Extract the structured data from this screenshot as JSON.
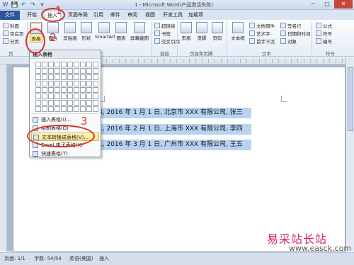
{
  "title": {
    "quick_access": [
      "W",
      "💾",
      "↶",
      "↷",
      "▾"
    ],
    "window_title": "1 - Microsoft Word(产品激活失败)"
  },
  "window_buttons": [
    "─",
    "□",
    "✕"
  ],
  "tabs": [
    "文件",
    "开始",
    "插入",
    "页面布局",
    "引用",
    "邮件",
    "审阅",
    "视图",
    "开发工具",
    "加载项"
  ],
  "ribbon": {
    "left_small": [
      "封面",
      "空白页",
      "分页"
    ],
    "groups": {
      "pages": "页",
      "links": "链接",
      "header_footer": "页眉和页脚",
      "text": "文本",
      "symbols": "符号"
    },
    "buttons": {
      "table": "表格",
      "picture": "图片",
      "clipart": "剪贴画",
      "shapes": "形状",
      "smartart": "SmartArt",
      "chart": "图表",
      "screenshot": "屏幕截图",
      "header": "页眉",
      "footer": "页脚",
      "page_num": "页码",
      "textbox": "文本框"
    },
    "links": [
      "超链接",
      "书签",
      "交叉引用"
    ],
    "text_small": [
      "文档部件",
      "艺术字",
      "首字下沉"
    ],
    "text_small2": [
      "签名行",
      "日期和时间",
      "对象"
    ],
    "symbols": [
      "公式",
      "符号",
      "编号"
    ]
  },
  "document": {
    "lines": [
      "3, 2016 年 1 月 1 日, 北京市 XXX 有限公司, 张三",
      "1, 2016 年 2 月 1 日, 上海市 XXX 有限公司, 李四",
      "1, 2016 年 3 月 1 日, 广州市 XXX 有限公司, 王五"
    ]
  },
  "dropdown": {
    "header": "插入表格",
    "items": [
      "插入表格(I)...",
      "绘制表格(D)",
      "文本转换成表格(V)...",
      "Excel 电子表格(X)",
      "快速表格(T)"
    ]
  },
  "annotations": [
    "1",
    "2",
    "3"
  ],
  "status": {
    "page": "页面: 1/1",
    "words": "字数: 54/54",
    "lang": "英语(美国)",
    "mode": "插入"
  },
  "watermark": {
    "text": "易采站长站",
    "url": "www.easck.com"
  }
}
